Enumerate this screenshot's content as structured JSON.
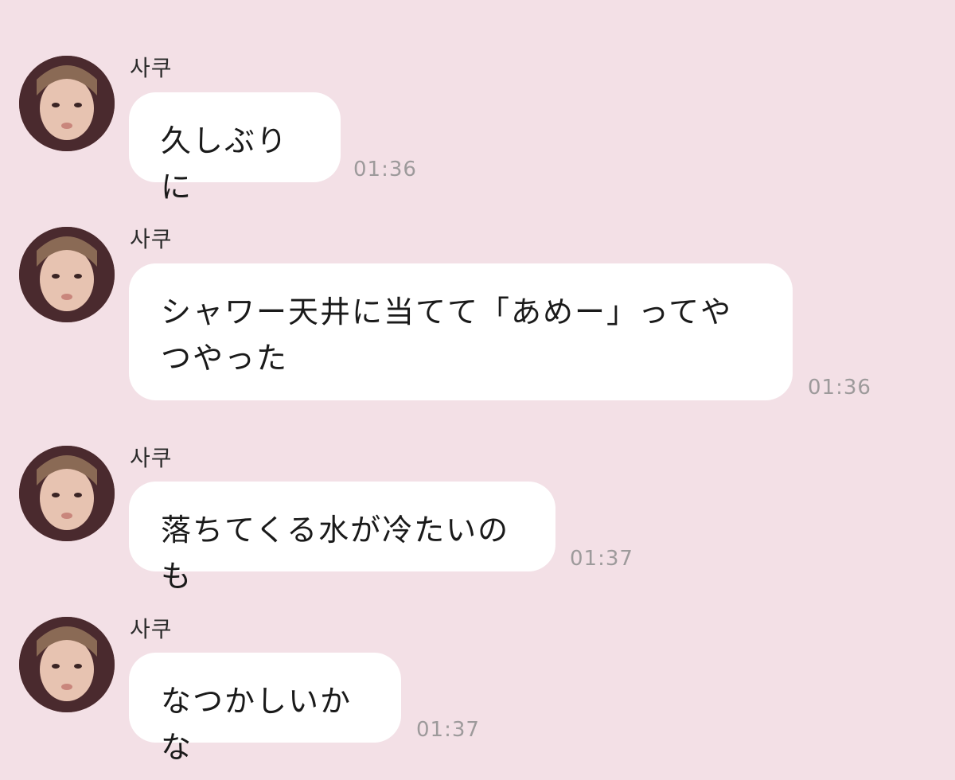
{
  "messages": [
    {
      "sender": "사쿠",
      "text": "久しぶりに",
      "time": "01:36"
    },
    {
      "sender": "사쿠",
      "text": "シャワー天井に当てて「あめー」ってやつやった",
      "time": "01:36"
    },
    {
      "sender": "사쿠",
      "text": "落ちてくる水が冷たいのも",
      "time": "01:37"
    },
    {
      "sender": "사쿠",
      "text": "なつかしいかな",
      "time": "01:37"
    }
  ],
  "colors": {
    "background": "#f3e0e6",
    "bubble": "#ffffff",
    "timestamp": "#9d9a9b"
  }
}
